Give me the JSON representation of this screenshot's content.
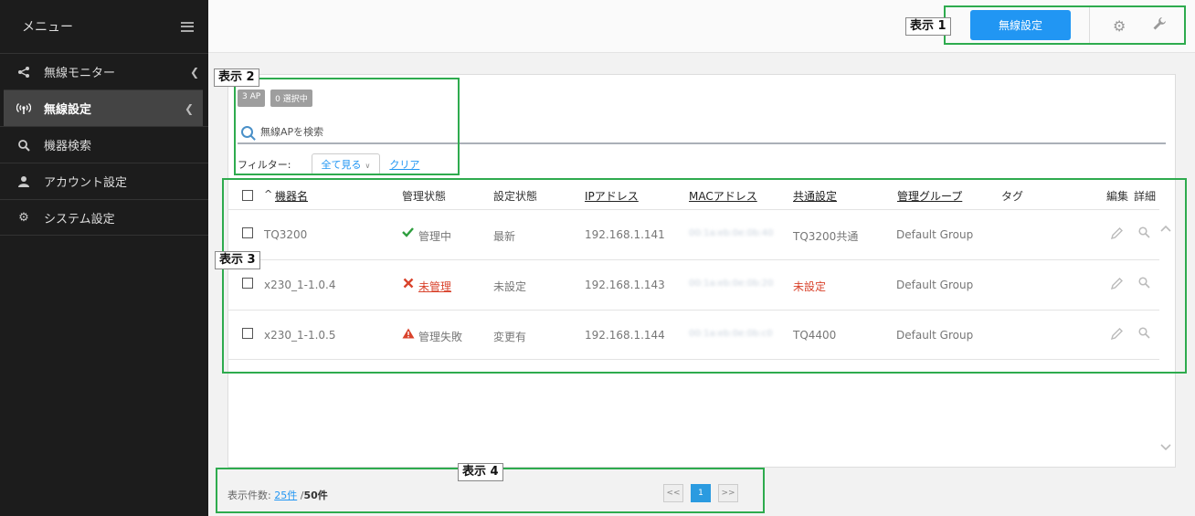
{
  "sidebar": {
    "title": "メニュー",
    "items": [
      {
        "label": "無線モニター",
        "icon": "share-icon"
      },
      {
        "label": "無線設定",
        "icon": "wifi-antenna-icon"
      },
      {
        "label": "機器検索",
        "icon": "search-icon"
      },
      {
        "label": "アカウント設定",
        "icon": "user-icon"
      },
      {
        "label": "システム設定",
        "icon": "gear-icon"
      }
    ]
  },
  "topbar": {
    "primary_button": "無線設定"
  },
  "panel": {
    "badge_ap": "3 AP",
    "badge_selected": "0 選択中",
    "search_placeholder": "無線APを検索",
    "filter_label": "フィルター:",
    "filter_value": "全て見る",
    "clear_label": "クリア"
  },
  "table": {
    "sort_indicator": "^",
    "headers": [
      "機器名",
      "管理状態",
      "設定状態",
      "IPアドレス",
      "MACアドレス",
      "共通設定",
      "管理グループ",
      "タグ",
      "編集",
      "詳細"
    ],
    "rows": [
      {
        "name": "TQ3200",
        "mgmt": "管理中",
        "config": "最新",
        "ip": "192.168.1.141",
        "mac": "00:1a:eb:0e:0b:40",
        "common": "TQ3200共通",
        "group": "Default Group"
      },
      {
        "name": "x230_1-1.0.4",
        "mgmt": "未管理",
        "config": "未設定",
        "ip": "192.168.1.143",
        "mac": "00:1a:eb:0e:0b:20",
        "common": "未設定",
        "group": "Default Group"
      },
      {
        "name": "x230_1-1.0.5",
        "mgmt": "管理失敗",
        "config": "変更有",
        "ip": "192.168.1.144",
        "mac": "00:1a:eb:0e:0b:c0",
        "common": "TQ4400",
        "group": "Default Group"
      }
    ]
  },
  "footer": {
    "count_label": "表示件数:",
    "per_page": "25件",
    "separator": "/",
    "total": "50件",
    "pager_prev": "<<",
    "pager_current": "1",
    "pager_next": ">>"
  },
  "annotations": [
    "表示 1",
    "表示 2",
    "表示 3",
    "表示 4"
  ],
  "colors": {
    "accent": "#2196f3",
    "annotation": "#2eab4e",
    "ok": "#2e9e3e",
    "error": "#d9432c"
  }
}
